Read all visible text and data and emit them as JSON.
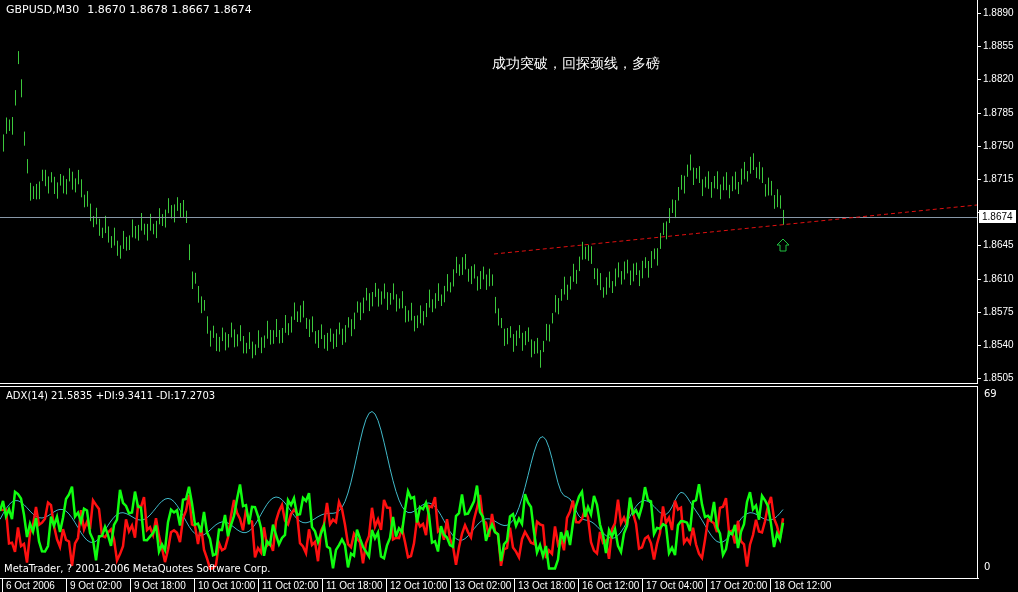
{
  "chart_header": {
    "symbol": "GBPUSD,M30",
    "quote": "1.8670 1.8678 1.8667 1.8674"
  },
  "annotation": "成功突破，回探颈线，多磅",
  "price_axis": [
    "1.8890",
    "1.8855",
    "1.8820",
    "1.8785",
    "1.8750",
    "1.8715",
    "1.8645",
    "1.8610",
    "1.8575",
    "1.8540",
    "1.8505"
  ],
  "current_price": "1.8674",
  "indicator": {
    "label": "ADX(14) 21.5835 +DI:9.3411 -DI:17.2703",
    "scale_max": "69",
    "scale_min": "0"
  },
  "copyright": "MetaTrader, ? 2001-2006 MetaQuotes Software Corp.",
  "time_axis": [
    "6 Oct 2006",
    "9 Oct 02:00",
    "9 Oct 18:00",
    "10 Oct 10:00",
    "11 Oct 02:00",
    "11 Oct 18:00",
    "12 Oct 10:00",
    "13 Oct 02:00",
    "13 Oct 18:00",
    "16 Oct 12:00",
    "17 Oct 04:00",
    "17 Oct 20:00",
    "18 Oct 12:00"
  ]
}
